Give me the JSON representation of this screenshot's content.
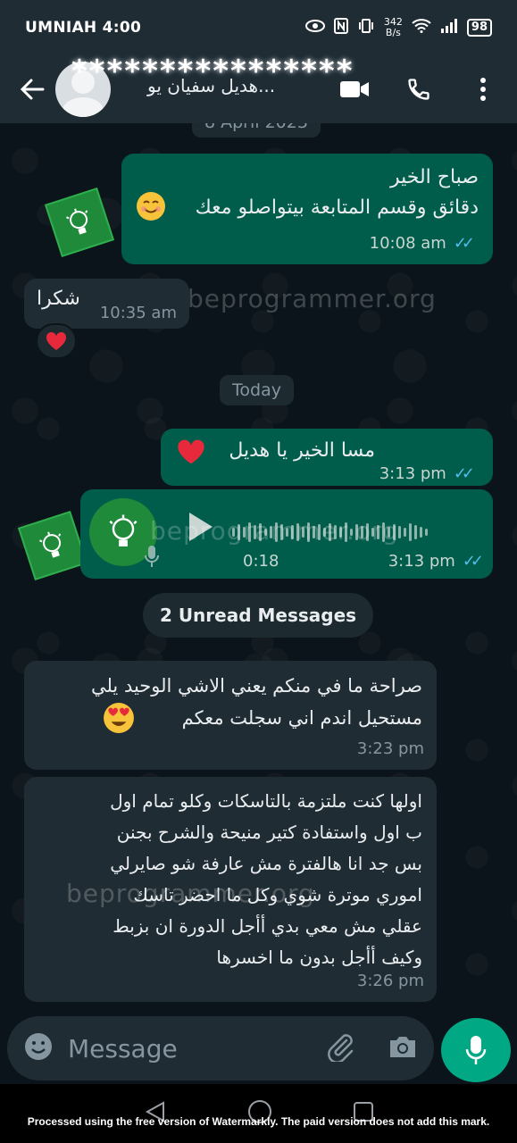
{
  "status": {
    "carrier": "UMNIAH 4:00",
    "net_speed": "342",
    "net_unit": "B/s",
    "battery": "98"
  },
  "header": {
    "contact_name": "****************",
    "contact_sub": "هديل سفيان يو..."
  },
  "chat": {
    "date_top": "8 April 2023",
    "date_today": "Today",
    "watermark": "beprogrammer.org",
    "messages": [
      {
        "dir": "out",
        "text": "صباح الخير\nدقائق وقسم المتابعة بيتواصلو معك",
        "time": "10:08 am"
      },
      {
        "dir": "in",
        "text": "شكرا",
        "time": "10:35 am"
      },
      {
        "dir": "out",
        "text": "مسا الخير يا هديل",
        "time": "3:13 pm"
      },
      {
        "dir": "in",
        "text": "صراحة ما في منكم يعني الاشي الوحيد يلي\nمستحيل  اندم اني سجلت معكم",
        "time": "3:23 pm"
      },
      {
        "dir": "in",
        "text": "اولها كنت ملتزمة بالتاسكات وكلو تمام اول\nب اول واستفادة كتير منيحة والشرح بجنن\nبس جد انا هالفترة مش عارفة شو صايرلي\nاموري موترة شوي وكل ما احضر تاسك\nعقلي مش معي بدي أأجل الدورة ان بزبط\nوكيف أأجل بدون ما اخسرها",
        "time": "3:26 pm"
      }
    ],
    "voice": {
      "duration": "0:18",
      "time": "3:13 pm"
    },
    "unread": "2 Unread Messages"
  },
  "composer": {
    "placeholder": "Message"
  },
  "footer_note": "Processed using the free version of Watermarkly. The paid version does not add this mark.",
  "colors": {
    "outgoing": "#005c4b",
    "incoming": "#202c33",
    "accent": "#00a884",
    "ticks": "#53bdeb"
  },
  "icons": [
    "back-arrow-icon",
    "video-call-icon",
    "phone-icon",
    "more-vert-icon",
    "emoji-icon",
    "attach-icon",
    "camera-icon",
    "mic-icon",
    "play-icon"
  ]
}
